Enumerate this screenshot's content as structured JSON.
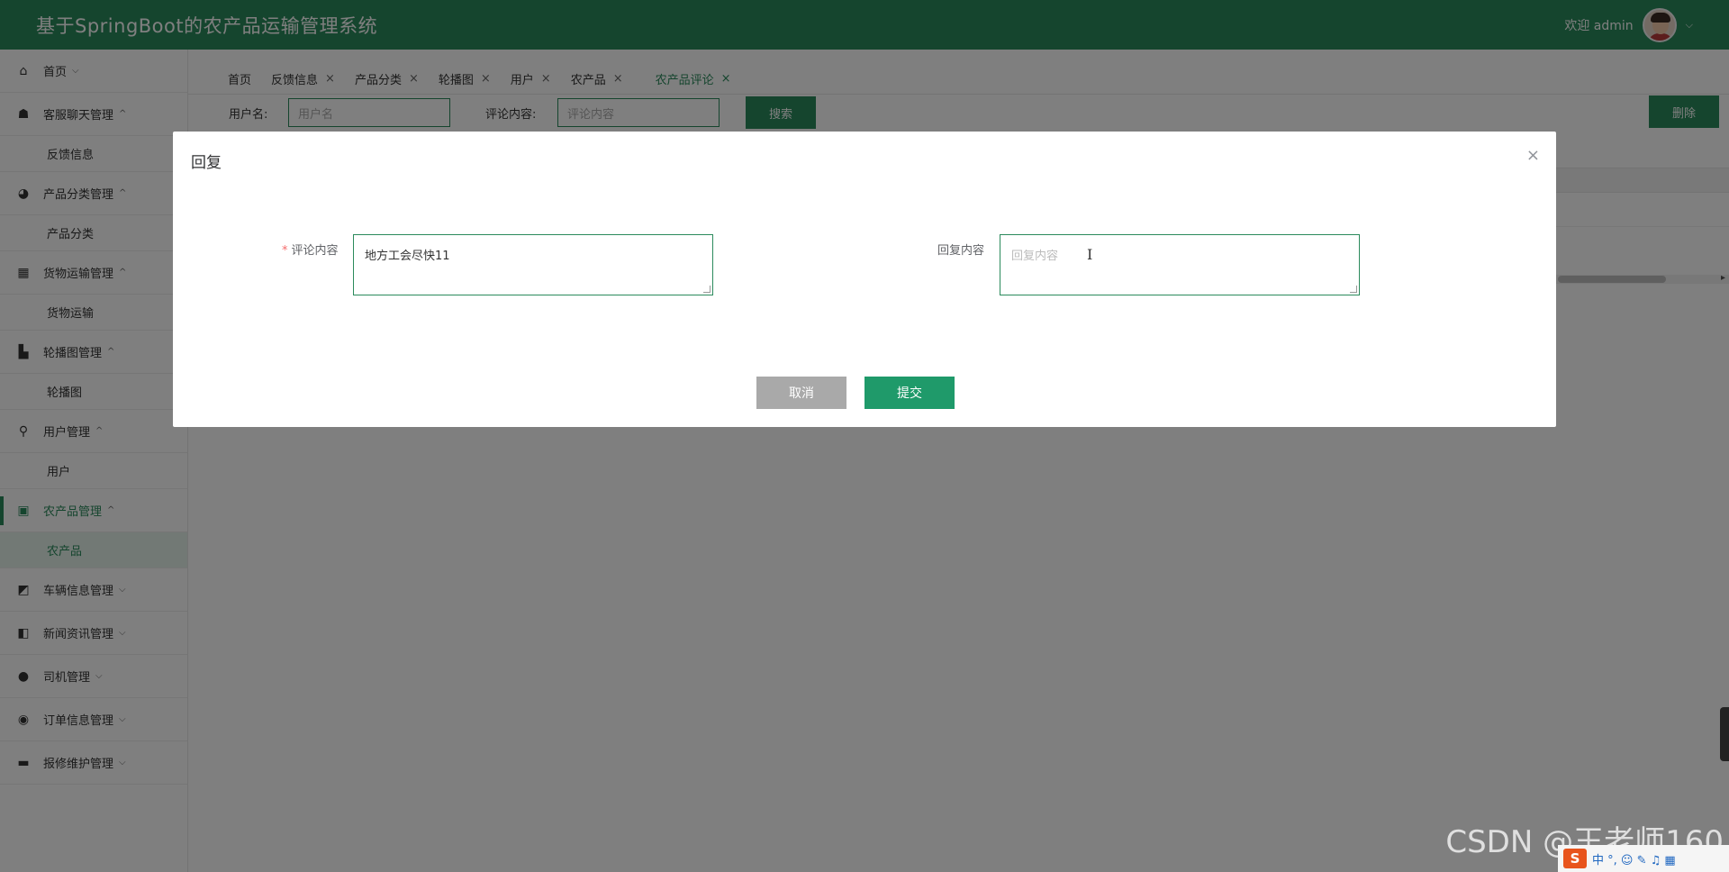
{
  "header": {
    "title": "基于SpringBoot的农产品运输管理系统",
    "welcome": "欢迎 admin",
    "chevron": "⌵"
  },
  "sidebar": {
    "items": [
      {
        "label": "首页",
        "icon": "home-icon",
        "glyph": "⌂",
        "arrow": "⌵"
      },
      {
        "label": "客服聊天管理",
        "icon": "chat-icon",
        "glyph": "☗",
        "arrow": "^"
      },
      {
        "label": "反馈信息",
        "sub": true
      },
      {
        "label": "产品分类管理",
        "icon": "pie-icon",
        "glyph": "◕",
        "arrow": "^"
      },
      {
        "label": "产品分类",
        "sub": true
      },
      {
        "label": "货物运输管理",
        "icon": "grid-icon",
        "glyph": "▦",
        "arrow": "^"
      },
      {
        "label": "货物运输",
        "sub": true
      },
      {
        "label": "轮播图管理",
        "icon": "bar-icon",
        "glyph": "▙",
        "arrow": "^"
      },
      {
        "label": "轮播图",
        "sub": true
      },
      {
        "label": "用户管理",
        "icon": "user-icon",
        "glyph": "⚲",
        "arrow": "^"
      },
      {
        "label": "用户",
        "sub": true
      },
      {
        "label": "农产品管理",
        "icon": "store-icon",
        "glyph": "▣",
        "arrow": "^",
        "active": true
      },
      {
        "label": "农产品",
        "sub": true,
        "active": true
      },
      {
        "label": "车辆信息管理",
        "icon": "vehicle-icon",
        "glyph": "◩",
        "arrow": "⌵"
      },
      {
        "label": "新闻资讯管理",
        "icon": "news-icon",
        "glyph": "◧",
        "arrow": "⌵"
      },
      {
        "label": "司机管理",
        "icon": "driver-icon",
        "glyph": "●",
        "arrow": "⌵"
      },
      {
        "label": "订单信息管理",
        "icon": "order-icon",
        "glyph": "◉",
        "arrow": "⌵"
      },
      {
        "label": "报修维护管理",
        "icon": "repair-icon",
        "glyph": "▬",
        "arrow": "⌵"
      }
    ]
  },
  "tabs": [
    {
      "label": "首页",
      "closable": false
    },
    {
      "label": "反馈信息",
      "closable": true
    },
    {
      "label": "产品分类",
      "closable": true
    },
    {
      "label": "轮播图",
      "closable": true
    },
    {
      "label": "用户",
      "closable": true
    },
    {
      "label": "农产品",
      "closable": true
    },
    {
      "label": "农产品评论",
      "closable": true,
      "active": true
    }
  ],
  "tab_close": "×",
  "search": {
    "username_label": "用户名:",
    "username_placeholder": "用户名",
    "comment_label": "评论内容:",
    "comment_placeholder": "评论内容",
    "search_button": "搜索",
    "delete_button": "删除"
  },
  "dialog": {
    "title": "回复",
    "close": "×",
    "comment_label": "评论内容",
    "required_mark": "*",
    "comment_value": "地方工会尽快11",
    "reply_label": "回复内容",
    "reply_placeholder": "回复内容",
    "cursor": "I",
    "cancel": "取消",
    "submit": "提交"
  },
  "watermark": "CSDN @王老师160",
  "tray": {
    "logo": "S",
    "icons": "中 °, ☺ ✎ ♫ ▦"
  },
  "colors": {
    "primary": "#2b8a5c",
    "submit": "#1f9a6a",
    "cancel": "#a9a9a9"
  }
}
